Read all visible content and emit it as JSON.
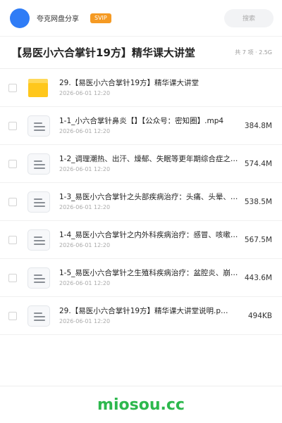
{
  "header": {
    "brand": "夸克网盘分享",
    "badge": "SVIP",
    "search_placeholder": "搜索"
  },
  "page": {
    "title": "【易医小六合掌针19方】精华课大讲堂",
    "meta": "共 7 项 · 2.5G"
  },
  "files": [
    {
      "name": "29.【易医小六合掌针19方】精华课大讲堂",
      "date": "2026-06-01 12:20",
      "size": "",
      "type": "folder"
    },
    {
      "name": "1-1_小六合掌针鼻炎【】【公众号：密知圈】.mp4",
      "date": "2026-06-01 12:20",
      "size": "384.8M",
      "type": "file"
    },
    {
      "name": "1-2_调理潮热、出汗、燥郁、失眠等更年期综合症之…",
      "date": "2026-06-01 12:20",
      "size": "574.4M",
      "type": "file"
    },
    {
      "name": "1-3_易医小六合掌针之头部疾病治疗：头痛、头晕、…",
      "date": "2026-06-01 12:20",
      "size": "538.5M",
      "type": "file"
    },
    {
      "name": "1-4_易医小六合掌针之内外科疾病治疗：感冒、咳嗽…",
      "date": "2026-06-01 12:20",
      "size": "567.5M",
      "type": "file"
    },
    {
      "name": "1-5_易医小六合掌针之生殖科疾病治疗：盆腔炎、崩…",
      "date": "2026-06-01 12:20",
      "size": "443.6M",
      "type": "file"
    },
    {
      "name": "29.【易医小六合掌针19方】精华课大讲堂说明.p…",
      "date": "2026-06-01 12:20",
      "size": "494KB",
      "type": "file"
    }
  ],
  "footer": {
    "site": "miosou.cc"
  },
  "colors": {
    "brand_blue": "#2f7cf6",
    "svip_orange": "#f59a23",
    "folder_yellow": "#ffc71c",
    "site_green": "#2db84d"
  }
}
